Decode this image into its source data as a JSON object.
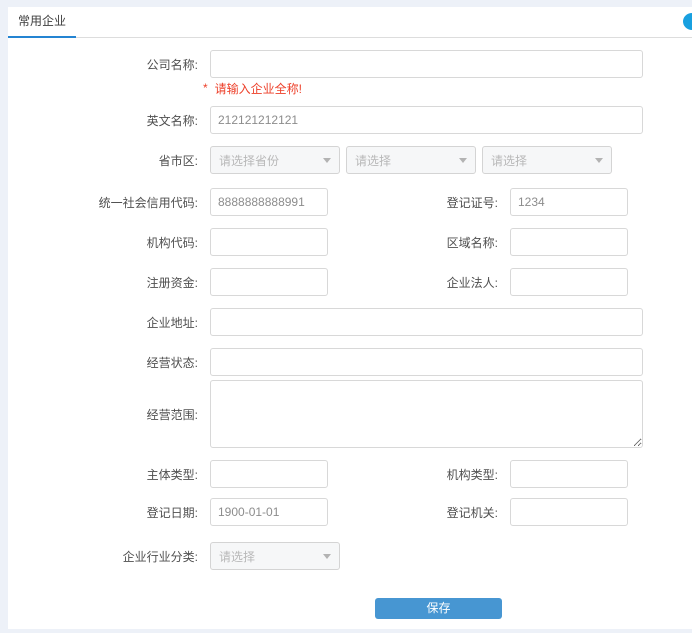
{
  "header": {
    "tab_label": "常用企业"
  },
  "form": {
    "company_name": {
      "label": "公司名称:",
      "value": "",
      "error_star": "*",
      "error_text": "请输入企业全称!"
    },
    "english_name": {
      "label": "英文名称:",
      "value": "212121212121"
    },
    "region": {
      "label": "省市区:",
      "province_placeholder": "请选择省份",
      "city_placeholder": "请选择",
      "district_placeholder": "请选择"
    },
    "credit_code": {
      "label": "统一社会信用代码:",
      "value": "8888888888991"
    },
    "registration_no": {
      "label": "登记证号:",
      "value": "1234"
    },
    "org_code": {
      "label": "机构代码:",
      "value": ""
    },
    "area_name": {
      "label": "区域名称:",
      "value": ""
    },
    "registered_capital": {
      "label": "注册资金:",
      "value": ""
    },
    "legal_person": {
      "label": "企业法人:",
      "value": ""
    },
    "address": {
      "label": "企业地址:",
      "value": ""
    },
    "business_status": {
      "label": "经营状态:",
      "value": ""
    },
    "business_scope": {
      "label": "经营范围:",
      "value": ""
    },
    "subject_type": {
      "label": "主体类型:",
      "value": ""
    },
    "org_type": {
      "label": "机构类型:",
      "value": ""
    },
    "registration_date": {
      "label": "登记日期:",
      "value": "1900-01-01"
    },
    "registration_authority": {
      "label": "登记机关:",
      "value": ""
    },
    "industry_category": {
      "label": "企业行业分类:",
      "placeholder": "请选择"
    }
  },
  "actions": {
    "save_label": "保存"
  },
  "colors": {
    "accent_blue": "#2484d2",
    "button_blue": "#4796d2",
    "error_red": "#ed3f29",
    "floating_blue": "#18a0e0"
  }
}
